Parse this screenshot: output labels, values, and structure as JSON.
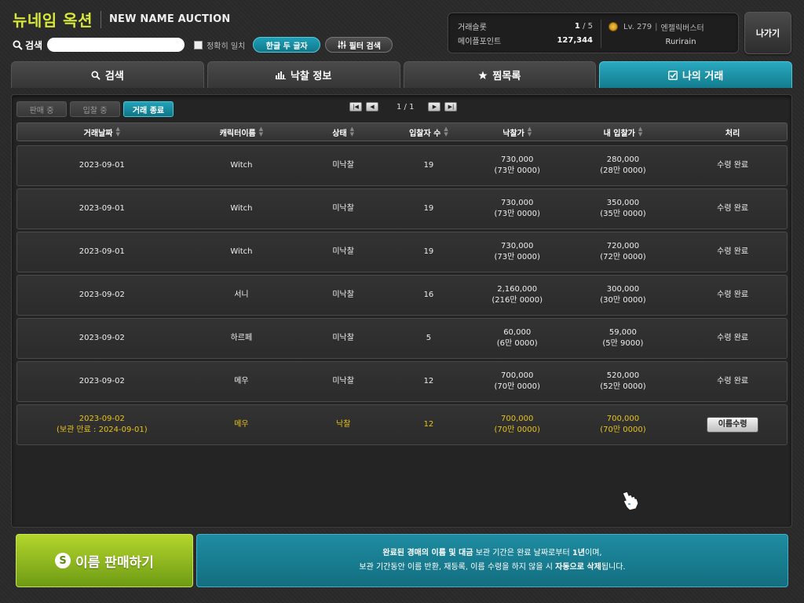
{
  "header": {
    "brand_kr": "뉴네임 옥션",
    "brand_en": "NEW NAME AUCTION",
    "search_label": "검색",
    "search_value": "",
    "exact_label": "정확히 일치",
    "hangul_btn": "한글 두 글자",
    "filter_btn": "필터 검색",
    "exit_btn": "나가기"
  },
  "info": {
    "slot_label": "거래슬롯",
    "slot_used": "1",
    "slot_sep": " / ",
    "slot_total": "5",
    "points_label": "메이플포인트",
    "points_value": "127,344",
    "level": "Lv. 279",
    "job": "엔젤릭버스터",
    "char_name": "Rurirain"
  },
  "tabs": [
    {
      "label": "검색",
      "icon": "search-icon"
    },
    {
      "label": "낙찰 정보",
      "icon": "bar-chart-icon"
    },
    {
      "label": "찜목록",
      "icon": "star-icon"
    },
    {
      "label": "나의 거래",
      "icon": "checkbox-icon",
      "active": true
    }
  ],
  "subtabs": [
    {
      "label": "판매 중"
    },
    {
      "label": "입찰 중"
    },
    {
      "label": "거래 종료",
      "active": true
    }
  ],
  "pager": {
    "current": "1",
    "sep": " / ",
    "total": "1"
  },
  "columns": [
    "거래날짜",
    "캐릭터이름",
    "상태",
    "입찰자 수",
    "낙찰가",
    "내 입찰가",
    "처리"
  ],
  "rows": [
    {
      "date": "2023-09-01",
      "date2": "",
      "name": "Witch",
      "status": "미낙찰",
      "bidders": "19",
      "price": "730,000",
      "price2": "(73만 0000)",
      "mybid": "280,000",
      "mybid2": "(28만 0000)",
      "action": "수령 완료"
    },
    {
      "date": "2023-09-01",
      "date2": "",
      "name": "Witch",
      "status": "미낙찰",
      "bidders": "19",
      "price": "730,000",
      "price2": "(73만 0000)",
      "mybid": "350,000",
      "mybid2": "(35만 0000)",
      "action": "수령 완료"
    },
    {
      "date": "2023-09-01",
      "date2": "",
      "name": "Witch",
      "status": "미낙찰",
      "bidders": "19",
      "price": "730,000",
      "price2": "(73만 0000)",
      "mybid": "720,000",
      "mybid2": "(72만 0000)",
      "action": "수령 완료"
    },
    {
      "date": "2023-09-02",
      "date2": "",
      "name": "서니",
      "status": "미낙찰",
      "bidders": "16",
      "price": "2,160,000",
      "price2": "(216만 0000)",
      "mybid": "300,000",
      "mybid2": "(30만 0000)",
      "action": "수령 완료"
    },
    {
      "date": "2023-09-02",
      "date2": "",
      "name": "하르페",
      "status": "미낙찰",
      "bidders": "5",
      "price": "60,000",
      "price2": "(6만 0000)",
      "mybid": "59,000",
      "mybid2": "(5만 9000)",
      "action": "수령 완료"
    },
    {
      "date": "2023-09-02",
      "date2": "",
      "name": "메우",
      "status": "미낙찰",
      "bidders": "12",
      "price": "700,000",
      "price2": "(70만 0000)",
      "mybid": "520,000",
      "mybid2": "(52만 0000)",
      "action": "수령 완료"
    },
    {
      "date": "2023-09-02",
      "date2": "(보관 만료 : 2024-09-01)",
      "name": "메우",
      "status": "낙찰",
      "bidders": "12",
      "price": "700,000",
      "price2": "(70만 0000)",
      "mybid": "700,000",
      "mybid2": "(70만 0000)",
      "action": "이름수령",
      "highlight": true,
      "action_is_button": true
    }
  ],
  "bottom": {
    "sell_icon": "S",
    "sell_label": "이름 판매하기",
    "notice_l1_a": "완료된 경매의 이름 및 대금",
    "notice_l1_b": " 보관 기간은 완료 날짜로부터 ",
    "notice_l1_c": "1년",
    "notice_l1_d": "이며,",
    "notice_l2_a": "보관 기간동안 이름 반환, 재등록, 이름 수령을 하지 않을 시 ",
    "notice_l2_b": "자동으로 삭제",
    "notice_l2_c": "됩니다."
  },
  "colors": {
    "accent": "#1a96ad",
    "brand": "#d8e83a",
    "highlight": "#e8c21a",
    "sell": "#8ab81e"
  }
}
